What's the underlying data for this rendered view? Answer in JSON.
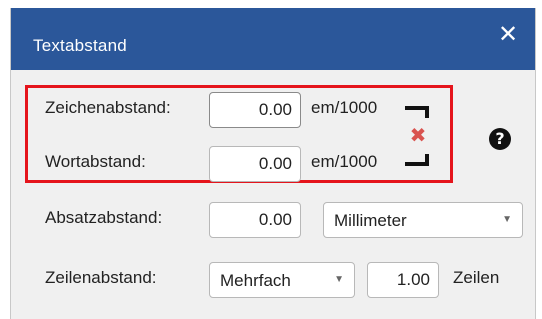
{
  "dialog": {
    "title": "Textabstand",
    "close_glyph": "✕"
  },
  "fields": {
    "char_spacing": {
      "label": "Zeichenabstand:",
      "value": "0.00",
      "unit": "em/1000"
    },
    "word_spacing": {
      "label": "Wortabstand:",
      "value": "0.00",
      "unit": "em/1000"
    },
    "paragraph_spacing": {
      "label": "Absatzabstand:",
      "value": "0.00",
      "unit_selected": "Millimeter"
    },
    "line_spacing": {
      "label": "Zeilenabstand:",
      "mode_selected": "Mehrfach",
      "value": "1.00",
      "unit": "Zeilen"
    }
  },
  "icons": {
    "link": "chain-link-broken-icon",
    "unlink_glyph": "✖",
    "help_glyph": "?"
  },
  "colors": {
    "titlebar": "#2b579a",
    "highlight_border": "#e5141c",
    "unlink": "#d9534f"
  }
}
